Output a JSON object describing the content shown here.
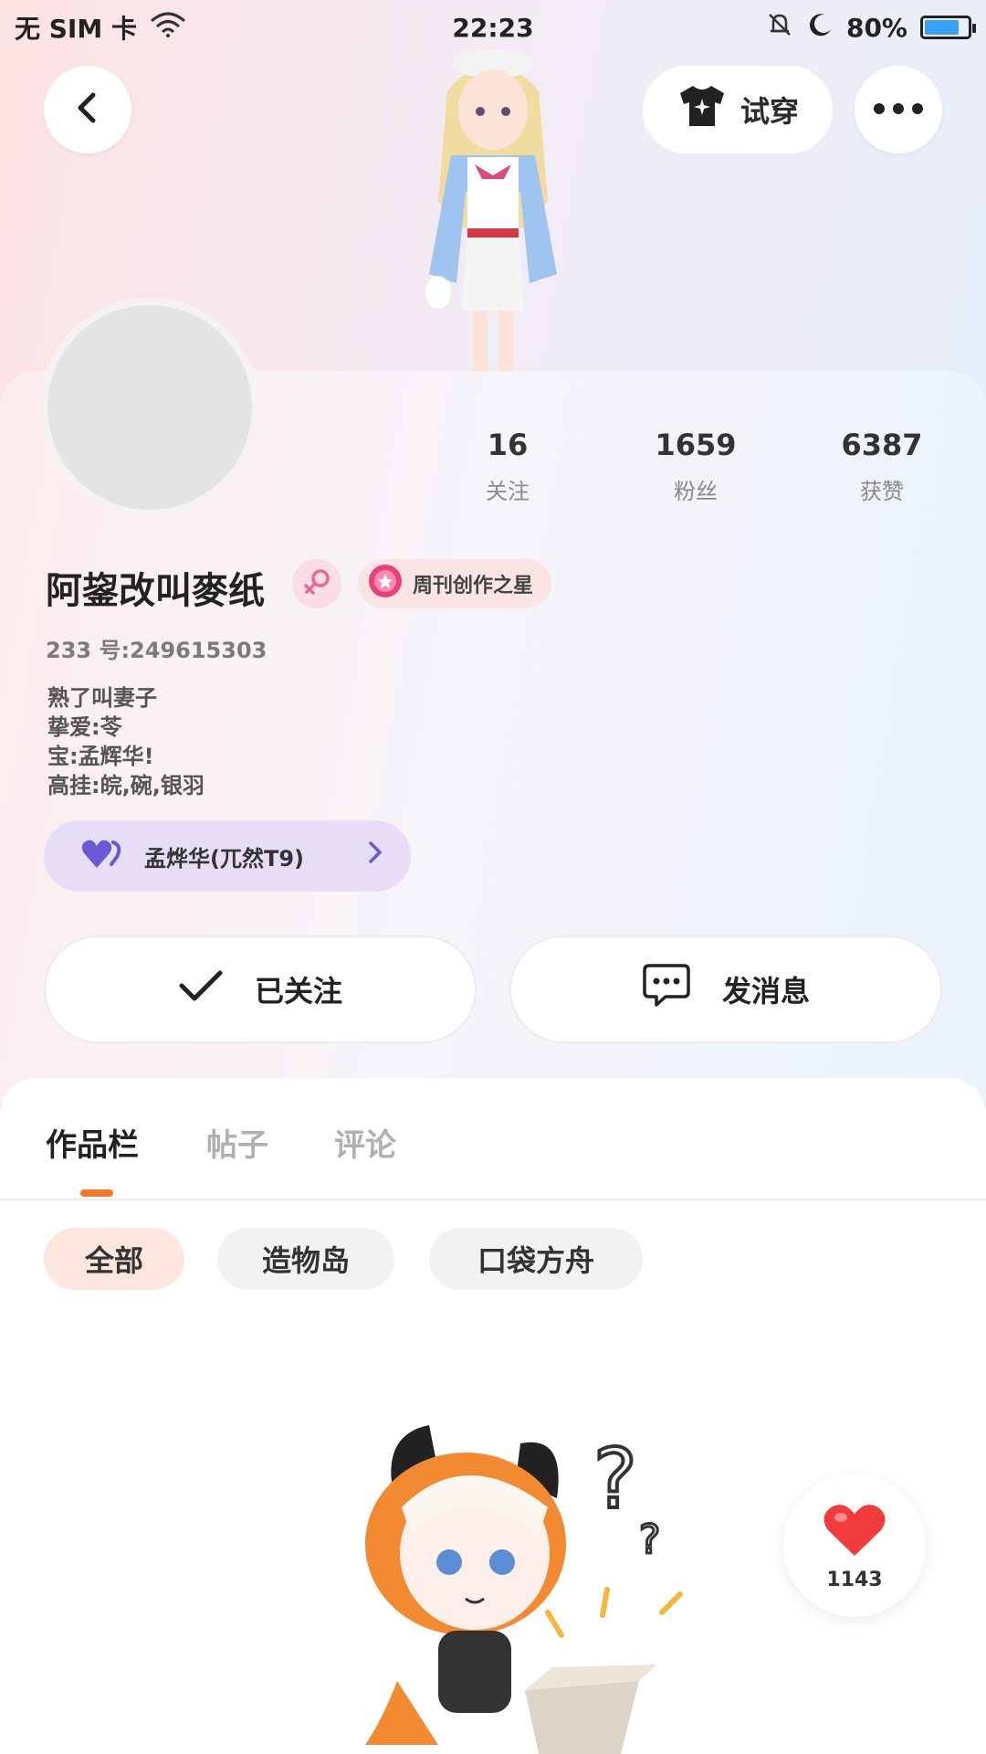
{
  "status_bar": {
    "carrier": "无 SIM 卡",
    "time": "22:23",
    "battery": "80%",
    "battery_level": 0.8
  },
  "header": {
    "try_on_label": "试穿"
  },
  "stats": [
    {
      "value": "16",
      "label": "关注"
    },
    {
      "value": "1659",
      "label": "粉丝"
    },
    {
      "value": "6387",
      "label": "获赞"
    }
  ],
  "profile": {
    "username": "阿鋆改叫麥纸",
    "title_badge": "周刊创作之星",
    "uid": "233 号:249615303",
    "bio": [
      "熟了叫妻子",
      "挚爱:苓",
      "宝:孟辉华!",
      "高挂:皖,碗,银羽"
    ],
    "bond": "孟烨华(兀然T9)"
  },
  "actions": {
    "follow_label": "已关注",
    "message_label": "发消息"
  },
  "tabs": [
    "作品栏",
    "帖子",
    "评论"
  ],
  "filters": [
    "全部",
    "造物岛",
    "口袋方舟"
  ],
  "like_count": "1143",
  "colors": {
    "accent_orange": "#f4792a",
    "bond_purple": "#6b58d6",
    "like_red": "#f23b3b"
  }
}
